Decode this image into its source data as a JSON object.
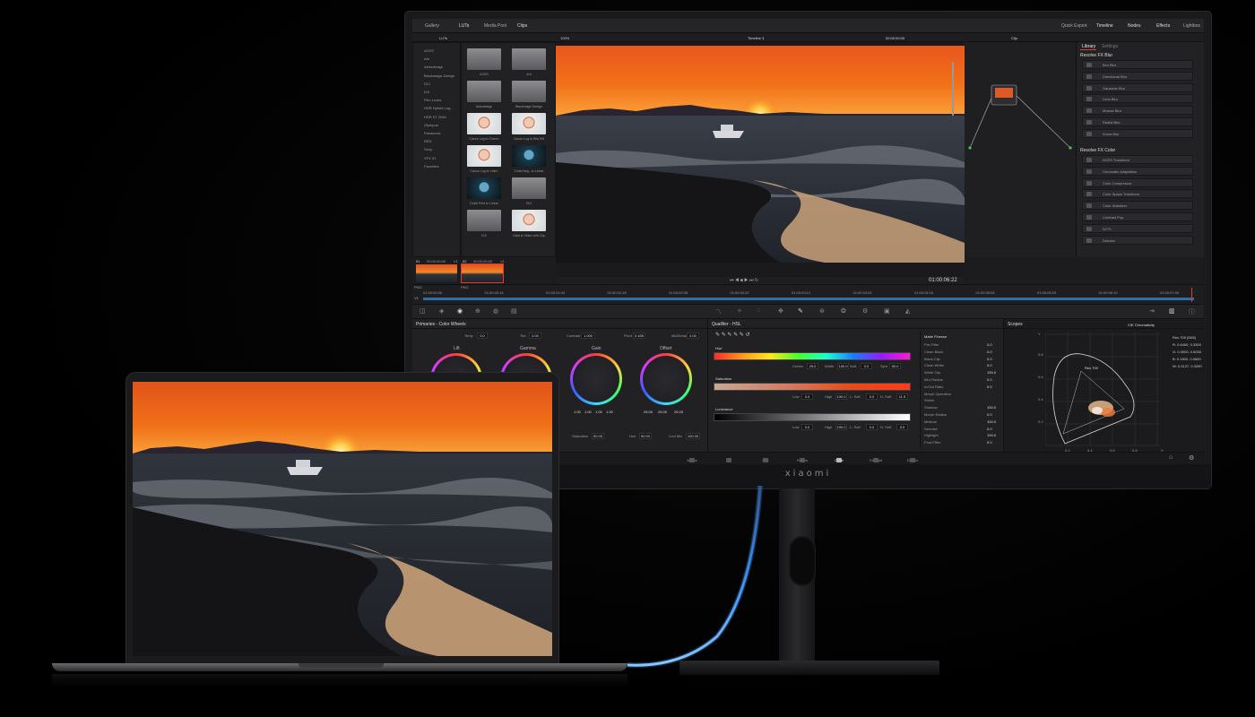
{
  "monitor": {
    "brand": "xiaomi",
    "topbar": {
      "left_tabs": [
        "Gallery",
        "LUTs",
        "Media Pool",
        "Clips"
      ],
      "right_tabs": [
        "Quick Export",
        "Timeline",
        "Nodes",
        "Effects",
        "Lightbox"
      ]
    },
    "toolbar": {
      "luts_label": "LUTs",
      "zoom": "100%",
      "timeline_name": "Timeline 3",
      "timecode": "00:00:00:00",
      "clip_label": "Clip"
    },
    "lut_tree": [
      "ACES",
      "Arri",
      "Astrodesign",
      "Blackmagic Design",
      "DCI",
      "DJI",
      "Film Looks",
      "HDR Hybrid Log...",
      "HDR ST 2084",
      "Olympus",
      "Panasonic",
      "RED",
      "Sony",
      "VFX IO",
      "Favorites"
    ],
    "lut_grid": [
      {
        "label": "ACES",
        "kind": "folder"
      },
      {
        "label": "Arri",
        "kind": "folder"
      },
      {
        "label": "Astrodesign",
        "kind": "folder"
      },
      {
        "label": "Blackmagic Design",
        "kind": "folder"
      },
      {
        "label": "Canon Log to Cineon",
        "kind": "face"
      },
      {
        "label": "Canon Log to Rec709",
        "kind": "face"
      },
      {
        "label": "Canon Log to Video",
        "kind": "face"
      },
      {
        "label": "Cintel Neg...to Linear",
        "kind": "face2"
      },
      {
        "label": "Cintel Print to Linear",
        "kind": "face2"
      },
      {
        "label": "DCI",
        "kind": "folder"
      },
      {
        "label": "DJI",
        "kind": "folder"
      },
      {
        "label": "Gala to Video with Clip",
        "kind": "face"
      }
    ],
    "viewer": {
      "timecode": "01:00:06:22"
    },
    "clips": [
      {
        "num": "01",
        "tc": "00:00:00:00",
        "track": "V1",
        "codec": "PNG"
      },
      {
        "num": "02",
        "tc": "00:00:00:00",
        "track": "V1",
        "codec": "PNG"
      }
    ],
    "timeline_ruler": [
      "01:00:00:00",
      "01:00:00:14",
      "01:00:01:04",
      "01:00:01:18",
      "01:00:02:08",
      "01:00:02:22",
      "01:00:03:12",
      "01:00:04:02",
      "01:00:04:16",
      "01:00:05:06",
      "01:00:05:20",
      "01:00:06:10",
      "01:00:07:00"
    ],
    "track_label": "V1",
    "library": {
      "tab_library": "Library",
      "tab_settings": "Settings",
      "blur_header": "Resolve FX Blur",
      "blur_items": [
        "Box Blur",
        "Directional Blur",
        "Gaussian Blur",
        "Lens Blur",
        "Mosaic Blur",
        "Radial Blur",
        "Zoom Blur"
      ],
      "color_header": "Resolve FX Color",
      "color_items": [
        "ACES Transform",
        "Chromatic Adaptation",
        "Color Compressor",
        "Color Space Transform",
        "Color Stabilizer",
        "Contrast Pop",
        "DCTL",
        "Dehaze"
      ]
    },
    "primaries": {
      "title": "Primaries - Color Wheels",
      "temp_label": "Temp",
      "temp_value": "0.0",
      "tint_label": "Tint",
      "tint_value": "0.00",
      "contrast_label": "Contrast",
      "contrast_value": "1.000",
      "pivot_label": "Pivot",
      "pivot_value": "0.435",
      "middetail_label": "Mid/Detail",
      "middetail_value": "0.00",
      "wheels": [
        {
          "label": "Lift",
          "values": []
        },
        {
          "label": "Gamma",
          "values": []
        },
        {
          "label": "Gain",
          "values": [
            "1.00",
            "1.00",
            "1.00",
            "1.00"
          ]
        },
        {
          "label": "Offset",
          "values": [
            "25.00",
            "25.00",
            "25.00"
          ]
        }
      ],
      "saturation_label": "Saturation",
      "saturation_value": "50.00",
      "hue_label": "Hue",
      "hue_value": "50.00",
      "lummix_label": "Lum Mix",
      "lummix_value": "100.00"
    },
    "qualifier": {
      "title": "Qualifier - HSL",
      "hue_label": "Hue",
      "hue_params": [
        {
          "label": "Center",
          "value": "29.0"
        },
        {
          "label": "Width",
          "value": "100.0"
        },
        {
          "label": "Soft",
          "value": "0.0"
        },
        {
          "label": "Sym",
          "value": "50.0"
        }
      ],
      "sat_label": "Saturation",
      "sat_params": [
        {
          "label": "Low",
          "value": "0.0"
        },
        {
          "label": "High",
          "value": "100.0"
        },
        {
          "label": "L. Soft",
          "value": "0.0"
        },
        {
          "label": "H. Soft",
          "value": "11.5"
        }
      ],
      "lum_label": "Luminance",
      "lum_params": [
        {
          "label": "Low",
          "value": "0.0"
        },
        {
          "label": "High",
          "value": "100.0"
        },
        {
          "label": "L. Soft",
          "value": "0.0"
        },
        {
          "label": "H. Soft",
          "value": "0.0"
        }
      ]
    },
    "matte": {
      "title": "Matte Finesse",
      "rows": [
        {
          "label": "Pre-Filter",
          "value": "0.0"
        },
        {
          "label": "Clean Black",
          "value": "0.0"
        },
        {
          "label": "Black Clip",
          "value": "0.0"
        },
        {
          "label": "Clean White",
          "value": "0.0"
        },
        {
          "label": "White Clip",
          "value": "100.0"
        },
        {
          "label": "Blur Radius",
          "value": "0.0"
        },
        {
          "label": "In/Out Ratio",
          "value": "0.0"
        },
        {
          "label": "Morph Operation",
          "value": ""
        },
        {
          "label": "Shrink",
          "value": ""
        },
        {
          "label": "Shadow",
          "value": "100.0"
        },
        {
          "label": "Morph Radius",
          "value": "0.0"
        },
        {
          "label": "Midtone",
          "value": "100.0"
        },
        {
          "label": "Denoise",
          "value": "0.0"
        },
        {
          "label": "Highlight",
          "value": "100.0"
        },
        {
          "label": "Post-Filter",
          "value": "0.0"
        }
      ]
    },
    "scopes": {
      "title": "Scopes",
      "mode": "CIE Chromaticity",
      "readout": [
        "Rec.709 (D65)",
        "R: 0.6400, 0.3300",
        "G: 0.3000, 0.6000",
        "B: 0.1500, 0.0600",
        "W: 0.3127, 0.3290"
      ],
      "gamut_label": "Rec.709",
      "y_ticks": [
        "0.8",
        "0.6",
        "0.4",
        "0.2"
      ],
      "x_ticks": [
        "0.2",
        "0.4",
        "0.6",
        "0.8"
      ],
      "axis_x": "X",
      "axis_y": "Y"
    },
    "pages": [
      "Media",
      "Cut",
      "Edit",
      "Fusion",
      "Color",
      "Fairlight",
      "Deliver"
    ],
    "active_page": "Color",
    "colors": {
      "accent_red": "#e63b2e",
      "active_blue": "#3a8fd6"
    }
  }
}
